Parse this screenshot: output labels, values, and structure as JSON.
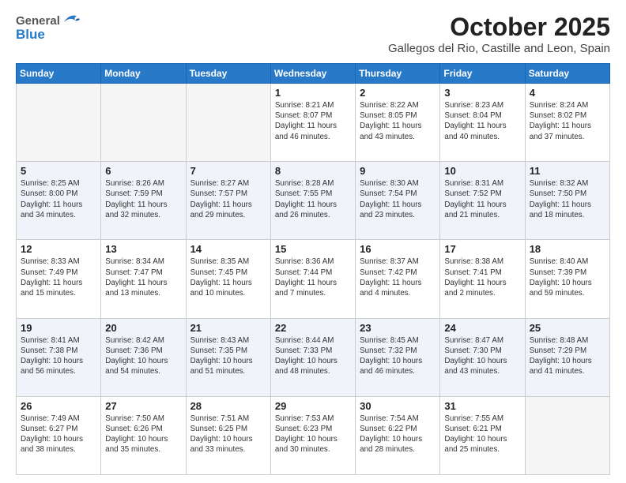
{
  "header": {
    "logo_general": "General",
    "logo_blue": "Blue",
    "month_title": "October 2025",
    "location": "Gallegos del Rio, Castille and Leon, Spain"
  },
  "weekdays": [
    "Sunday",
    "Monday",
    "Tuesday",
    "Wednesday",
    "Thursday",
    "Friday",
    "Saturday"
  ],
  "weeks": [
    [
      {
        "day": "",
        "info": ""
      },
      {
        "day": "",
        "info": ""
      },
      {
        "day": "",
        "info": ""
      },
      {
        "day": "1",
        "info": "Sunrise: 8:21 AM\nSunset: 8:07 PM\nDaylight: 11 hours\nand 46 minutes."
      },
      {
        "day": "2",
        "info": "Sunrise: 8:22 AM\nSunset: 8:05 PM\nDaylight: 11 hours\nand 43 minutes."
      },
      {
        "day": "3",
        "info": "Sunrise: 8:23 AM\nSunset: 8:04 PM\nDaylight: 11 hours\nand 40 minutes."
      },
      {
        "day": "4",
        "info": "Sunrise: 8:24 AM\nSunset: 8:02 PM\nDaylight: 11 hours\nand 37 minutes."
      }
    ],
    [
      {
        "day": "5",
        "info": "Sunrise: 8:25 AM\nSunset: 8:00 PM\nDaylight: 11 hours\nand 34 minutes."
      },
      {
        "day": "6",
        "info": "Sunrise: 8:26 AM\nSunset: 7:59 PM\nDaylight: 11 hours\nand 32 minutes."
      },
      {
        "day": "7",
        "info": "Sunrise: 8:27 AM\nSunset: 7:57 PM\nDaylight: 11 hours\nand 29 minutes."
      },
      {
        "day": "8",
        "info": "Sunrise: 8:28 AM\nSunset: 7:55 PM\nDaylight: 11 hours\nand 26 minutes."
      },
      {
        "day": "9",
        "info": "Sunrise: 8:30 AM\nSunset: 7:54 PM\nDaylight: 11 hours\nand 23 minutes."
      },
      {
        "day": "10",
        "info": "Sunrise: 8:31 AM\nSunset: 7:52 PM\nDaylight: 11 hours\nand 21 minutes."
      },
      {
        "day": "11",
        "info": "Sunrise: 8:32 AM\nSunset: 7:50 PM\nDaylight: 11 hours\nand 18 minutes."
      }
    ],
    [
      {
        "day": "12",
        "info": "Sunrise: 8:33 AM\nSunset: 7:49 PM\nDaylight: 11 hours\nand 15 minutes."
      },
      {
        "day": "13",
        "info": "Sunrise: 8:34 AM\nSunset: 7:47 PM\nDaylight: 11 hours\nand 13 minutes."
      },
      {
        "day": "14",
        "info": "Sunrise: 8:35 AM\nSunset: 7:45 PM\nDaylight: 11 hours\nand 10 minutes."
      },
      {
        "day": "15",
        "info": "Sunrise: 8:36 AM\nSunset: 7:44 PM\nDaylight: 11 hours\nand 7 minutes."
      },
      {
        "day": "16",
        "info": "Sunrise: 8:37 AM\nSunset: 7:42 PM\nDaylight: 11 hours\nand 4 minutes."
      },
      {
        "day": "17",
        "info": "Sunrise: 8:38 AM\nSunset: 7:41 PM\nDaylight: 11 hours\nand 2 minutes."
      },
      {
        "day": "18",
        "info": "Sunrise: 8:40 AM\nSunset: 7:39 PM\nDaylight: 10 hours\nand 59 minutes."
      }
    ],
    [
      {
        "day": "19",
        "info": "Sunrise: 8:41 AM\nSunset: 7:38 PM\nDaylight: 10 hours\nand 56 minutes."
      },
      {
        "day": "20",
        "info": "Sunrise: 8:42 AM\nSunset: 7:36 PM\nDaylight: 10 hours\nand 54 minutes."
      },
      {
        "day": "21",
        "info": "Sunrise: 8:43 AM\nSunset: 7:35 PM\nDaylight: 10 hours\nand 51 minutes."
      },
      {
        "day": "22",
        "info": "Sunrise: 8:44 AM\nSunset: 7:33 PM\nDaylight: 10 hours\nand 48 minutes."
      },
      {
        "day": "23",
        "info": "Sunrise: 8:45 AM\nSunset: 7:32 PM\nDaylight: 10 hours\nand 46 minutes."
      },
      {
        "day": "24",
        "info": "Sunrise: 8:47 AM\nSunset: 7:30 PM\nDaylight: 10 hours\nand 43 minutes."
      },
      {
        "day": "25",
        "info": "Sunrise: 8:48 AM\nSunset: 7:29 PM\nDaylight: 10 hours\nand 41 minutes."
      }
    ],
    [
      {
        "day": "26",
        "info": "Sunrise: 7:49 AM\nSunset: 6:27 PM\nDaylight: 10 hours\nand 38 minutes."
      },
      {
        "day": "27",
        "info": "Sunrise: 7:50 AM\nSunset: 6:26 PM\nDaylight: 10 hours\nand 35 minutes."
      },
      {
        "day": "28",
        "info": "Sunrise: 7:51 AM\nSunset: 6:25 PM\nDaylight: 10 hours\nand 33 minutes."
      },
      {
        "day": "29",
        "info": "Sunrise: 7:53 AM\nSunset: 6:23 PM\nDaylight: 10 hours\nand 30 minutes."
      },
      {
        "day": "30",
        "info": "Sunrise: 7:54 AM\nSunset: 6:22 PM\nDaylight: 10 hours\nand 28 minutes."
      },
      {
        "day": "31",
        "info": "Sunrise: 7:55 AM\nSunset: 6:21 PM\nDaylight: 10 hours\nand 25 minutes."
      },
      {
        "day": "",
        "info": ""
      }
    ]
  ]
}
